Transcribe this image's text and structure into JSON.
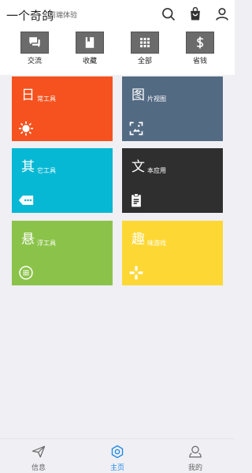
{
  "header": {
    "title": "一个奇鸽",
    "subtitle": "前端体验",
    "icons": [
      "search-icon",
      "shopping-bag-icon",
      "user-icon"
    ]
  },
  "quick_actions": [
    {
      "label": "交流",
      "icon": "chat-icon"
    },
    {
      "label": "收藏",
      "icon": "bookmark-icon"
    },
    {
      "label": "全部",
      "icon": "grid-icon"
    },
    {
      "label": "省钱",
      "icon": "dollar-icon"
    }
  ],
  "tiles": [
    {
      "big": "日",
      "small": "常工具",
      "color": "#f5521f",
      "icon": "sun-icon"
    },
    {
      "big": "图",
      "small": "片视图",
      "color": "#536a83",
      "icon": "image-focus-icon"
    },
    {
      "big": "其",
      "small": "它工具",
      "color": "#06b8d4",
      "icon": "tag-icon"
    },
    {
      "big": "文",
      "small": "本应用",
      "color": "#2f2f2f",
      "icon": "clipboard-icon"
    },
    {
      "big": "悬",
      "small": "浮工具",
      "color": "#8bc34a",
      "icon": "grid-circle-icon"
    },
    {
      "big": "趣",
      "small": "味游戏",
      "color": "#fdd835",
      "icon": "gamepad-icon"
    }
  ],
  "bottom_nav": [
    {
      "label": "信息",
      "icon": "send-icon",
      "active": false
    },
    {
      "label": "主页",
      "icon": "hexagon-icon",
      "active": true
    },
    {
      "label": "我的",
      "icon": "profile-icon",
      "active": false
    }
  ],
  "colors": {
    "active": "#1e88e5",
    "inactive": "#666666",
    "background": "#efeff4"
  }
}
